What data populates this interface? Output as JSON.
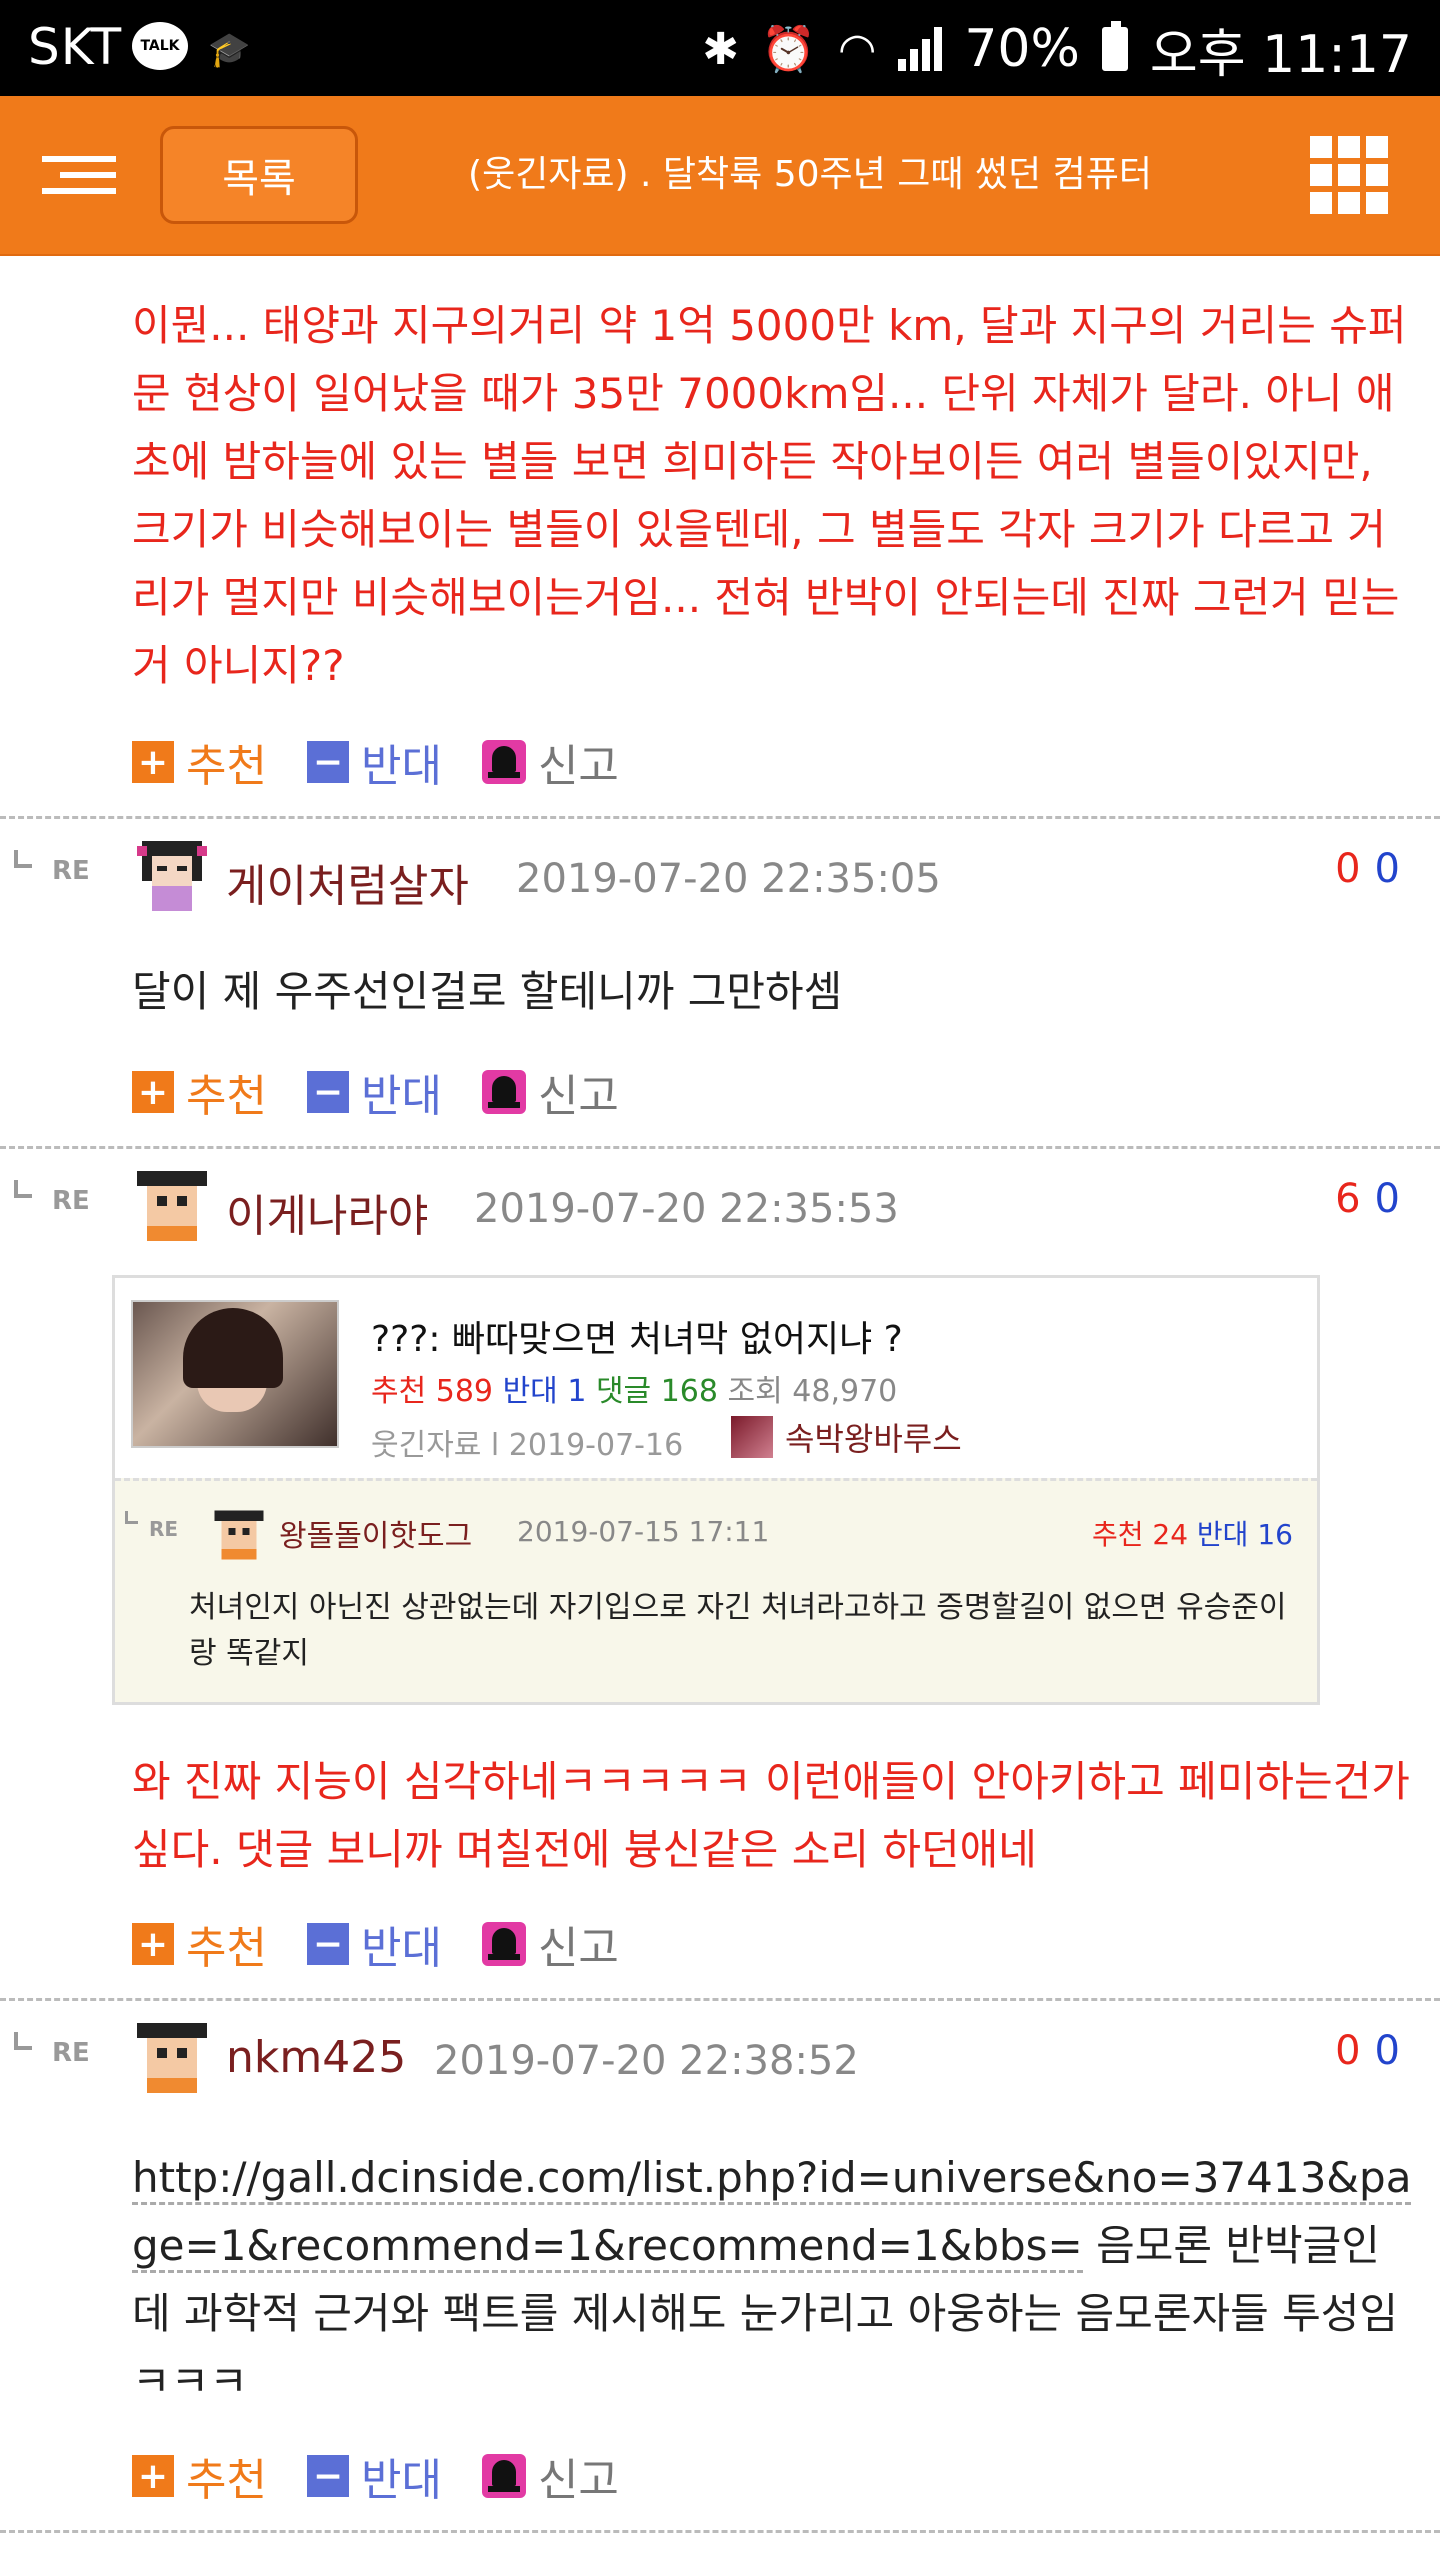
{
  "status_bar": {
    "carrier": "SKT",
    "talk_badge": "TALK",
    "battery": "70%",
    "time": "오후 11:17"
  },
  "header": {
    "list_button": "목록",
    "title": "(웃긴자료) . 달착륙 50주년 그때 썼던 컴퓨터"
  },
  "top_comment": {
    "text": "이뭔... 태양과 지구의거리 약 1억 5000만 km, 달과 지구의 거리는 슈퍼문 현상이 일어났을 때가 35만 7000km임... 단위 자체가 달라. 아니 애초에 밤하늘에 있는 별들 보면 희미하든 작아보이든 여러 별들이있지만, 크기가 비슷해보이는 별들이 있을텐데, 그 별들도 각자 크기가 다르고 거리가 멀지만 비슷해보이는거임... 전혀 반박이 안되는데 진짜 그런거 믿는거 아니지??"
  },
  "actions": {
    "recommend": "추천",
    "oppose": "반대",
    "report": "신고",
    "plus_symbol": "+",
    "minus_symbol": "−"
  },
  "re_label": "RE",
  "comments": [
    {
      "nick": "게이처럼살자",
      "date": "2019-07-20 22:35:05",
      "up": "0",
      "down": "0",
      "text": "달이 제 우주선인걸로 할테니까 그만하셈"
    },
    {
      "nick": "이게나라야",
      "date": "2019-07-20 22:35:53",
      "up": "6",
      "down": "0",
      "text": "와 진짜 지능이 심각하네ㅋㅋㅋㅋㅋ 이런애들이 안아키하고 페미하는건가 싶다. 댓글 보니까 며칠전에 븅신같은 소리 하던애네"
    },
    {
      "nick": "nkm425",
      "date": "2019-07-20 22:38:52",
      "up": "0",
      "down": "0",
      "url": "http://gall.dcinside.com/list.php?id=universe&no=37413&page=1&recommend=1&recommend=1&bbs=",
      "text": " 음모론 반박글인데 과학적 근거와 팩트를 제시해도 눈가리고 아웅하는 음모론자들 투성임ㅋㅋㅋ"
    }
  ],
  "embed_card": {
    "title": "???: 빠따맞으면 처녀막 없어지냐 ?",
    "rec_label": "추천",
    "rec_count": "589",
    "opp_label": "반대",
    "opp_count": "1",
    "comment_label": "댓글",
    "comment_count": "168",
    "view_label": "조회",
    "view_count": "48,970",
    "meta": "웃긴자료 l 2019-07-16",
    "author": "속박왕바루스",
    "reply": {
      "nick": "왕돌돌이핫도그",
      "date": "2019-07-15 17:11",
      "rec_label": "추천",
      "rec": "24",
      "opp_label": "반대",
      "opp": "16",
      "text": "처녀인지 아닌진 상관없는데 자기입으로 자긴 처녀라고하고 증명할길이 없으면 유승준이랑 똑같지"
    }
  },
  "colors": {
    "accent": "#f07a1a",
    "red_text": "#e8261c",
    "blue": "#2244cc",
    "oppose": "#5b6fd6"
  }
}
